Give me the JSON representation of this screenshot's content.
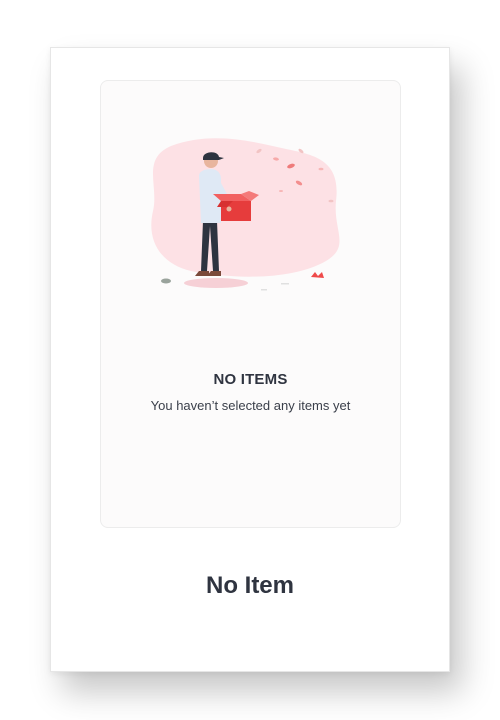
{
  "empty_state": {
    "title": "NO ITEMS",
    "subtitle": "You haven’t selected any items yet",
    "illustration_icon": "person-holding-box-illustration"
  },
  "footer": {
    "label": "No Item"
  },
  "colors": {
    "accent": "#ef4a4a",
    "blob": "#fde1e5",
    "text_dark": "#2f3440",
    "panel_bg": "#fcfbfb"
  }
}
